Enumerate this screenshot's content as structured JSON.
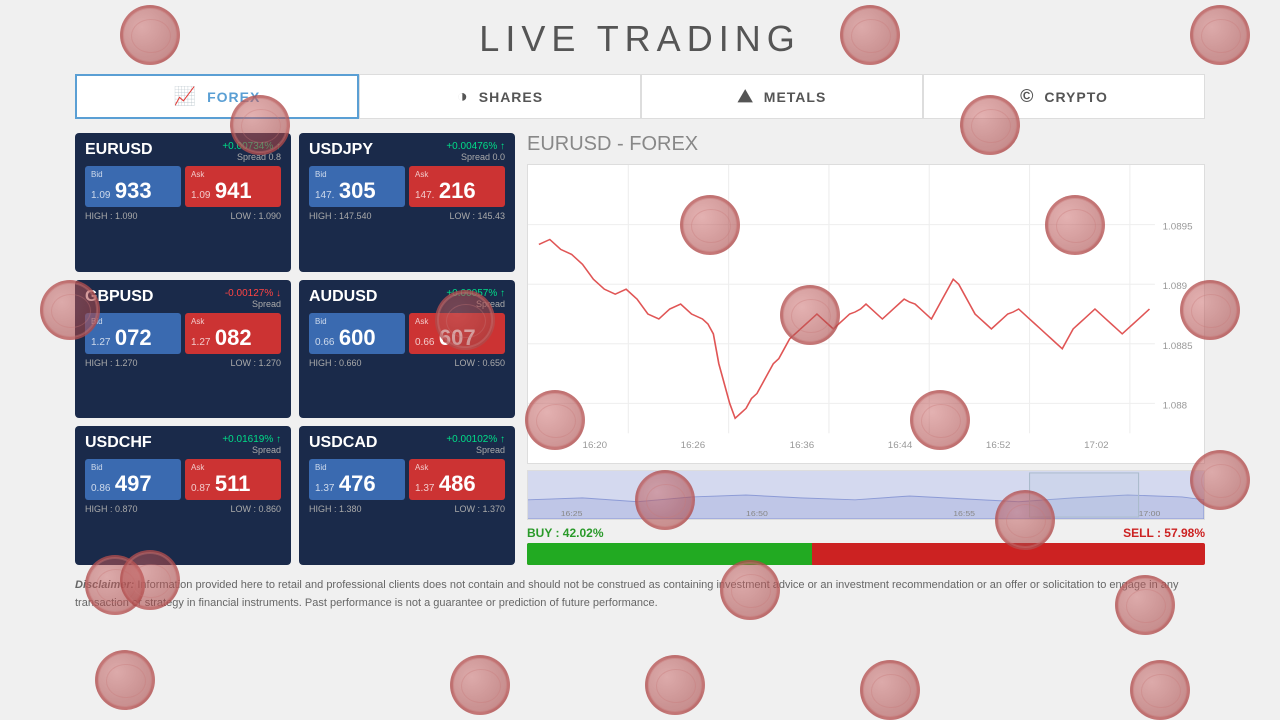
{
  "page": {
    "title": "LIVE TRADING"
  },
  "tabs": [
    {
      "id": "forex",
      "label": "FOREX",
      "icon": "📈",
      "active": true
    },
    {
      "id": "shares",
      "label": "SHARES",
      "icon": "🥧",
      "active": false
    },
    {
      "id": "metals",
      "label": "METALS",
      "icon": "🏔",
      "active": false
    },
    {
      "id": "crypto",
      "label": "CRYPTO",
      "icon": "©",
      "active": false
    }
  ],
  "cards": [
    {
      "symbol": "EURUSD",
      "change": "+0.00734%",
      "direction": "up",
      "spread_label": "Spread 0.8",
      "bid_label": "Bid",
      "bid_prefix": "1.09",
      "bid_value": "933",
      "ask_label": "Ask",
      "ask_prefix": "1.09",
      "ask_value": "941",
      "high": "HIGH : 1.090",
      "low": "LOW : 1.090",
      "change_class": "positive"
    },
    {
      "symbol": "USDJPY",
      "change": "+0.00476%",
      "direction": "up",
      "spread_label": "Spread 0.0",
      "bid_label": "Bid",
      "bid_prefix": "147.",
      "bid_value": "305",
      "ask_label": "Ask",
      "ask_prefix": "147.",
      "ask_value": "216",
      "high": "HIGH : 147.540",
      "low": "LOW : 145.43",
      "change_class": "positive"
    },
    {
      "symbol": "GBPUSD",
      "change": "-0.00127%",
      "direction": "down",
      "spread_label": "Spread",
      "bid_label": "Bid",
      "bid_prefix": "1.27",
      "bid_value": "072",
      "ask_label": "Ask",
      "ask_prefix": "1.27",
      "ask_value": "082",
      "high": "HIGH : 1.270",
      "low": "LOW : 1.270",
      "change_class": "negative"
    },
    {
      "symbol": "AUDUSD",
      "change": "+0.00057%",
      "direction": "up",
      "spread_label": "Spread",
      "bid_label": "Bid",
      "bid_prefix": "0.66",
      "bid_value": "600",
      "ask_label": "Ask",
      "ask_prefix": "0.66",
      "ask_value": "607",
      "high": "HIGH : 0.660",
      "low": "LOW : 0.650",
      "change_class": "positive"
    },
    {
      "symbol": "USDCHF",
      "change": "+0.01619%",
      "direction": "up",
      "spread_label": "Spread",
      "bid_label": "Bid",
      "bid_prefix": "0.86",
      "bid_value": "497",
      "ask_label": "Ask",
      "ask_prefix": "0.87",
      "ask_value": "511",
      "high": "HIGH : 0.870",
      "low": "LOW : 0.860",
      "change_class": "positive"
    },
    {
      "symbol": "USDCAD",
      "change": "+0.00102%",
      "direction": "up",
      "spread_label": "Spread",
      "bid_label": "Bid",
      "bid_prefix": "1.37",
      "bid_value": "476",
      "ask_label": "Ask",
      "ask_prefix": "1.37",
      "ask_value": "486",
      "high": "HIGH : 1.380",
      "low": "LOW : 1.370",
      "change_class": "positive"
    }
  ],
  "chart": {
    "title_pair": "EURUSD",
    "title_type": " - FOREX",
    "y_labels": [
      "1.0895",
      "1.089",
      "1.0885",
      "1.088"
    ],
    "x_labels": [
      "16:20",
      "16:26",
      "16:36",
      "16:44",
      "16:52",
      "17:02"
    ]
  },
  "buy_sell": {
    "buy_label": "BUY : 42.02%",
    "sell_label": "SELL : 57.98%",
    "buy_pct": 42.02
  },
  "disclaimer": {
    "text": "Disclaimer: Information provided here to retail and professional clients does not contain and should not be construed as containing investment advice or an investment recommendation or an offer or solicitation to engage in any transaction or strategy in financial instruments. Past performance is not a guarantee or prediction of future performance."
  }
}
